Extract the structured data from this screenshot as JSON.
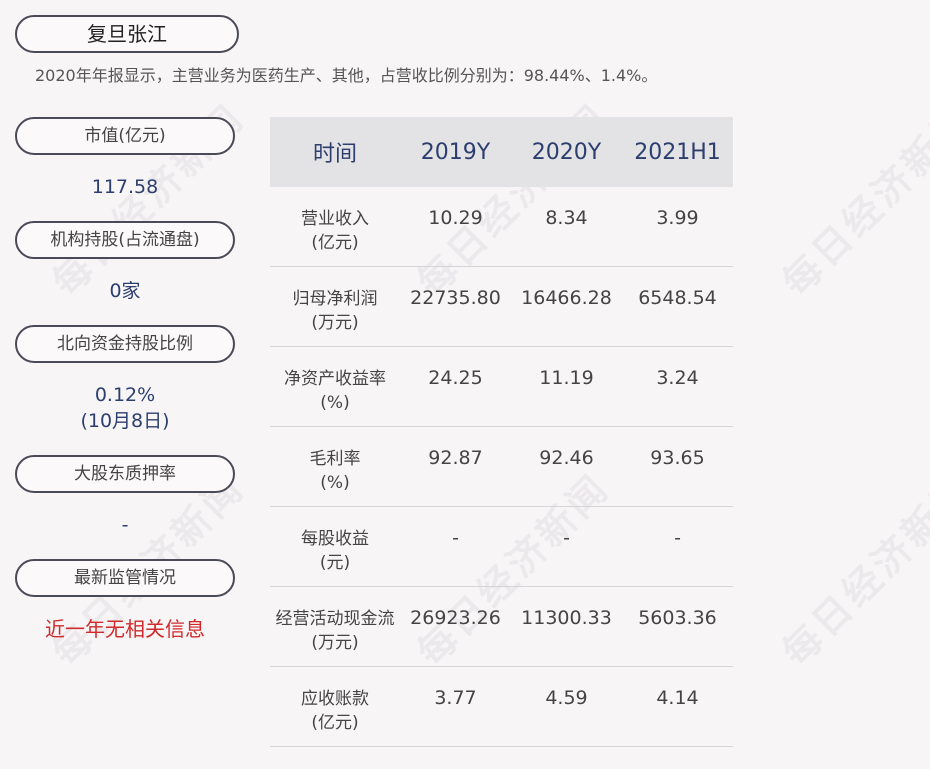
{
  "header": {
    "company": "复旦张江",
    "summary": "2020年年报显示，主营业务为医药生产、其他，占营收比例分别为：98.44%、1.4%。"
  },
  "sidebar": {
    "items": [
      {
        "label": "市值(亿元)",
        "value": "117.58",
        "value2": ""
      },
      {
        "label": "机构持股(占流通盘)",
        "value": "0家",
        "value2": ""
      },
      {
        "label": "北向资金持股比例",
        "value": "0.12%",
        "value2": "(10月8日)"
      },
      {
        "label": "大股东质押率",
        "value": "-",
        "value2": ""
      },
      {
        "label": "最新监管情况",
        "value": "近一年无相关信息",
        "value2": ""
      }
    ]
  },
  "table": {
    "headers": [
      "时间",
      "2019Y",
      "2020Y",
      "2021H1"
    ],
    "rows": [
      {
        "label": "营业收入",
        "unit": "(亿元)",
        "values": [
          "10.29",
          "8.34",
          "3.99"
        ]
      },
      {
        "label": "归母净利润",
        "unit": "(万元)",
        "values": [
          "22735.80",
          "16466.28",
          "6548.54"
        ]
      },
      {
        "label": "净资产收益率",
        "unit": "(%)",
        "values": [
          "24.25",
          "11.19",
          "3.24"
        ]
      },
      {
        "label": "毛利率",
        "unit": "(%)",
        "values": [
          "92.87",
          "92.46",
          "93.65"
        ]
      },
      {
        "label": "每股收益",
        "unit": "(元)",
        "values": [
          "-",
          "-",
          "-"
        ]
      },
      {
        "label": "经营活动现金流",
        "unit": "(万元)",
        "values": [
          "26923.26",
          "11300.33",
          "5603.36"
        ]
      },
      {
        "label": "应收账款",
        "unit": "(亿元)",
        "values": [
          "3.77",
          "4.59",
          "4.14"
        ]
      }
    ]
  },
  "watermark": "每日经济新闻"
}
